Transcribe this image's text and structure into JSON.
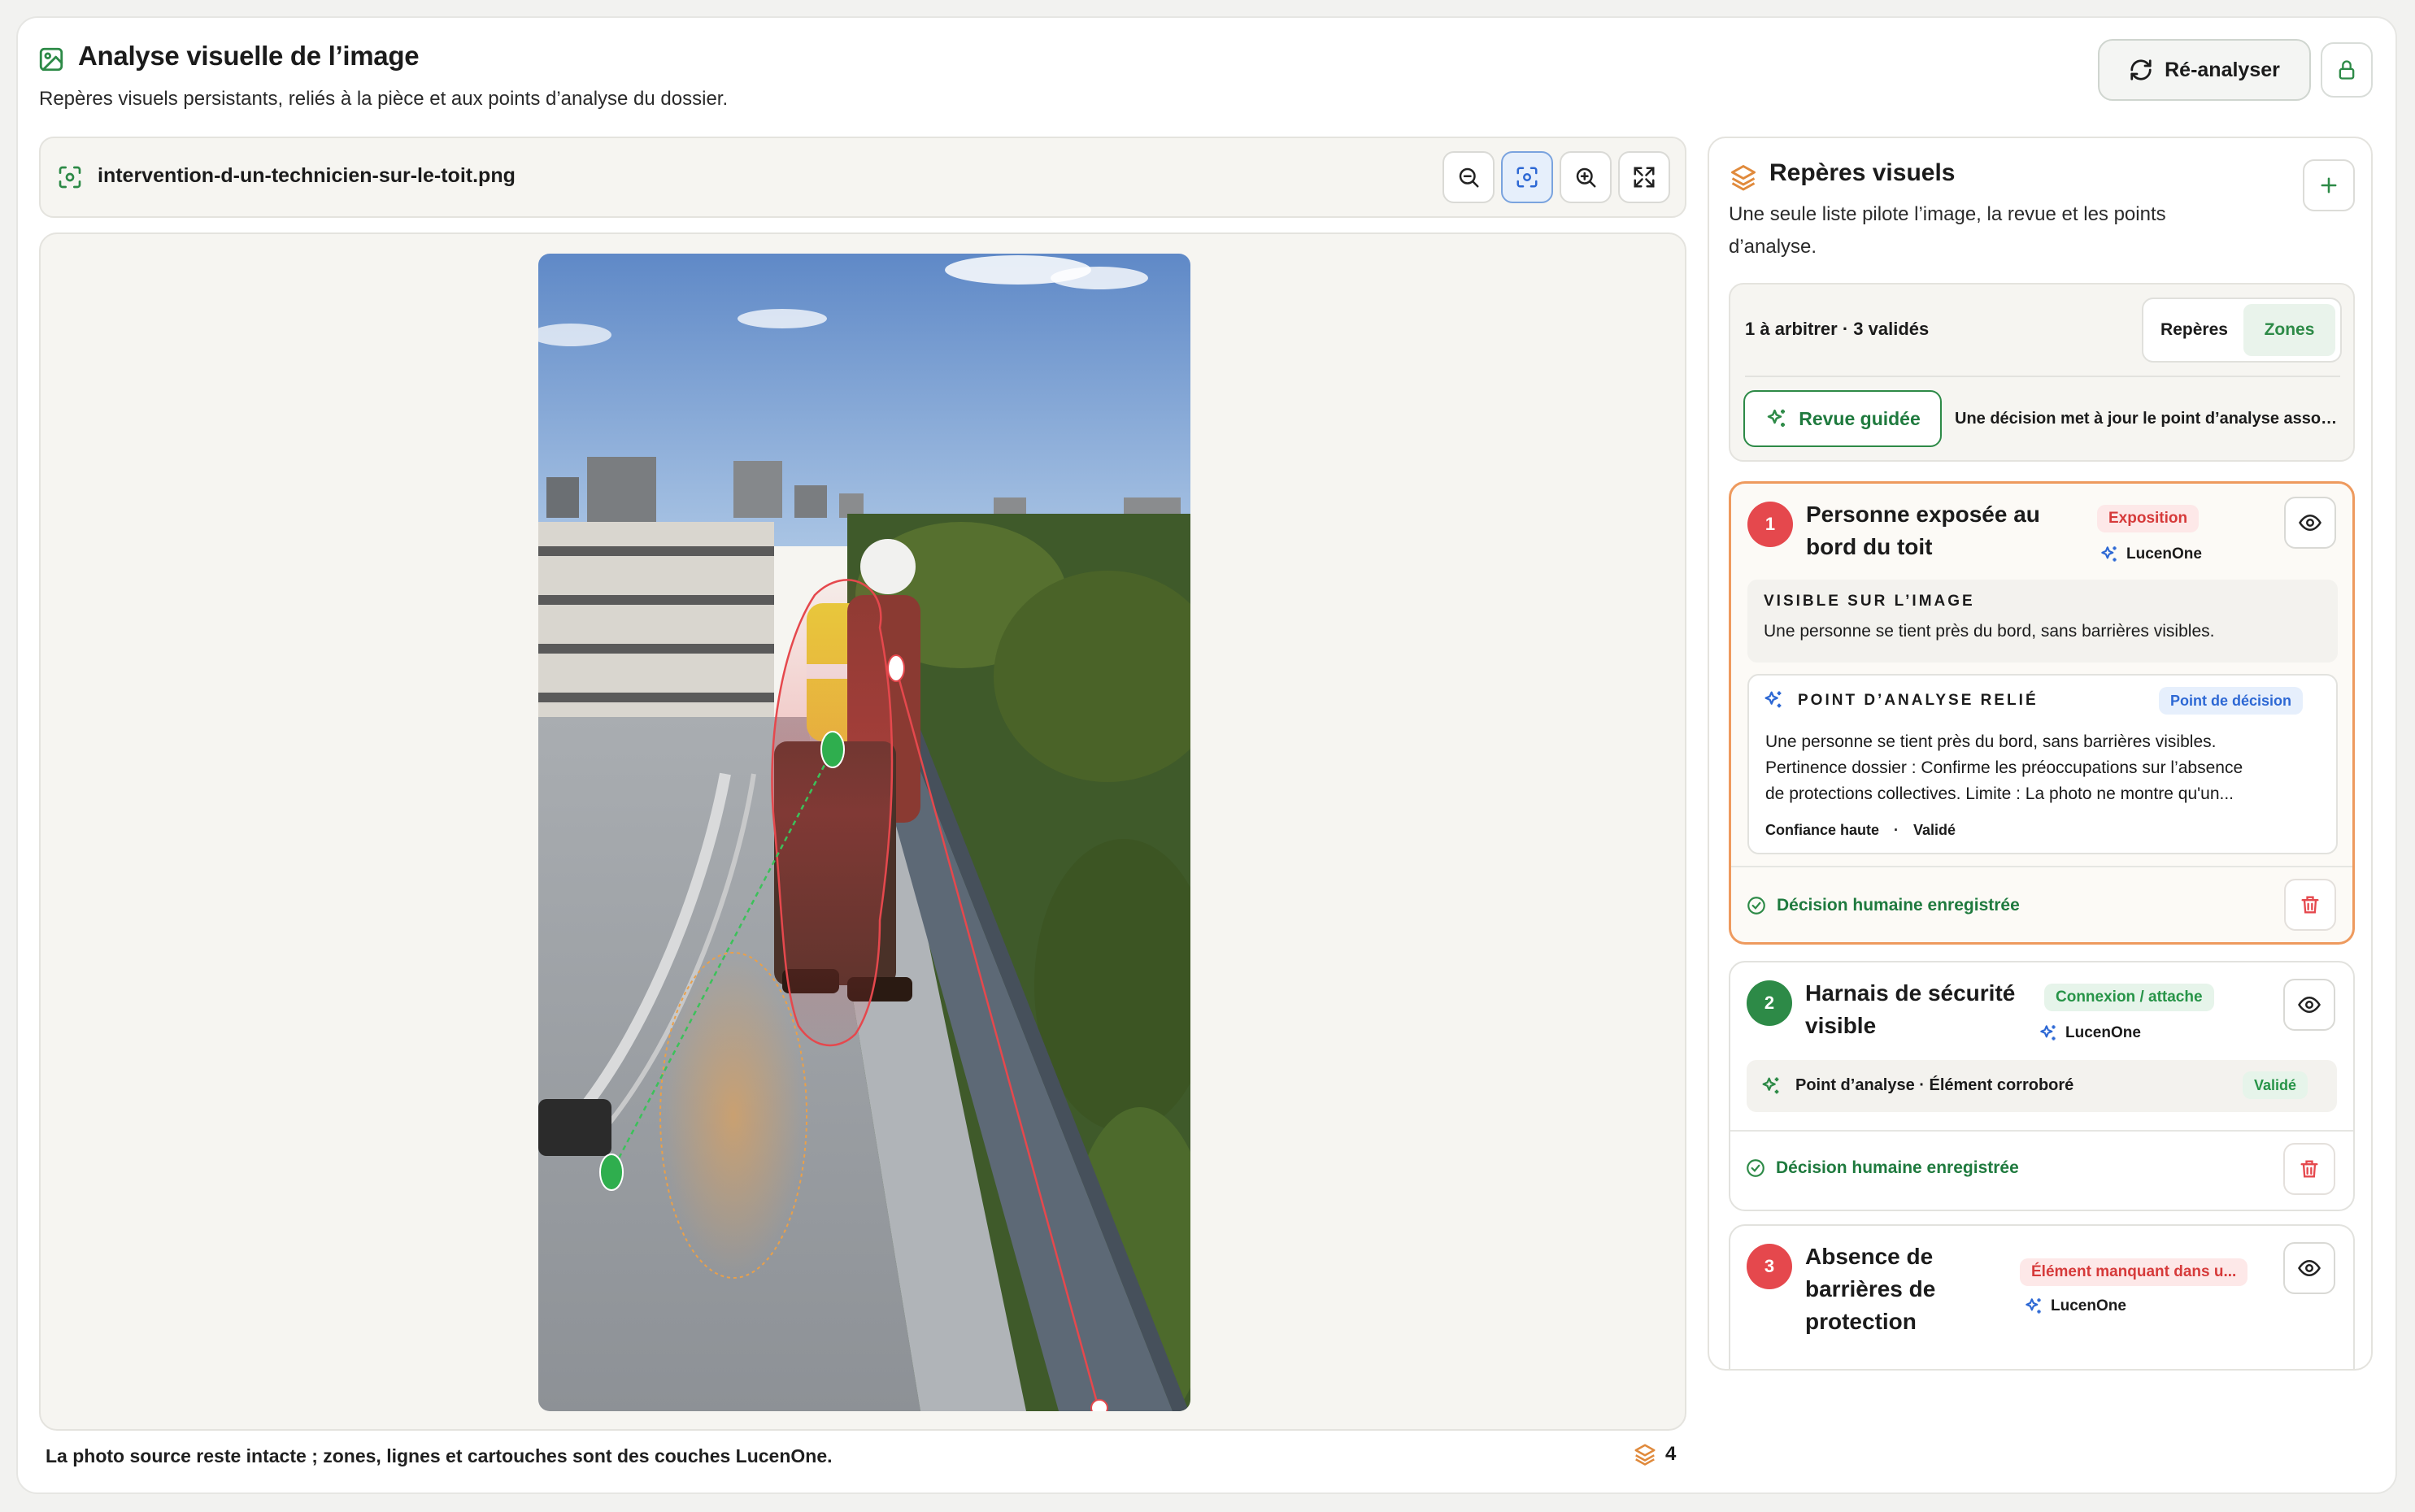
{
  "header": {
    "title": "Analyse visuelle de l’image",
    "subtitle": "Repères visuels persistants, reliés à la pièce et aux points d’analyse du dossier.",
    "reanalyze_label": "Ré-analyser"
  },
  "viewer": {
    "file_name": "intervention-d-un-technicien-sur-le-toit.png",
    "footnote": "La photo source reste intacte ; zones, lignes et cartouches sont des couches LucenOne.",
    "layer_count": "4"
  },
  "panel": {
    "title": "Repères visuels",
    "subtitle": "Une seule liste pilote l’image, la revue et les points d’analyse.",
    "summary": "1 à arbitrer · 3 validés",
    "segments": [
      "Repères",
      "Zones"
    ],
    "active_segment": "Zones",
    "guided_review_label": "Revue guidée",
    "guided_review_note": "Une décision met à jour le point d’analyse associé."
  },
  "items": [
    {
      "number": "1",
      "title_line1": "Personne exposée au",
      "title_line2": "bord du toit",
      "badge": "Exposition",
      "source": "LucenOne",
      "visible_label": "VISIBLE SUR L’IMAGE",
      "visible_text": "Une personne se tient près du bord, sans barrières visibles.",
      "linked_label": "POINT D’ANALYSE RELIÉ",
      "linked_badge": "Point de décision",
      "linked_line1": "Une personne se tient près du bord, sans barrières visibles.",
      "linked_line2": "Pertinence dossier : Confirme les préoccupations sur l’absence",
      "linked_line3": "de protections collectives. Limite : La photo ne montre qu'un...",
      "confidence": "Confiance haute",
      "sep": "·",
      "status": "Validé",
      "decision": "Décision humaine enregistrée"
    },
    {
      "number": "2",
      "title_line1": "Harnais de sécurité",
      "title_line2": "visible",
      "badge": "Connexion / attache",
      "source": "LucenOne",
      "row_text": "Point d’analyse · Élément corroboré",
      "row_status": "Validé",
      "decision": "Décision humaine enregistrée"
    },
    {
      "number": "3",
      "title_line1": "Absence de",
      "title_line2": "barrières de",
      "title_line3": "protection",
      "badge": "Élément manquant dans u...",
      "source": "LucenOne"
    }
  ],
  "colors": {
    "accent_green": "#2d8a47",
    "accent_red": "#e5484d",
    "accent_orange": "#ee9a5e",
    "accent_blue": "#2d68d4"
  }
}
